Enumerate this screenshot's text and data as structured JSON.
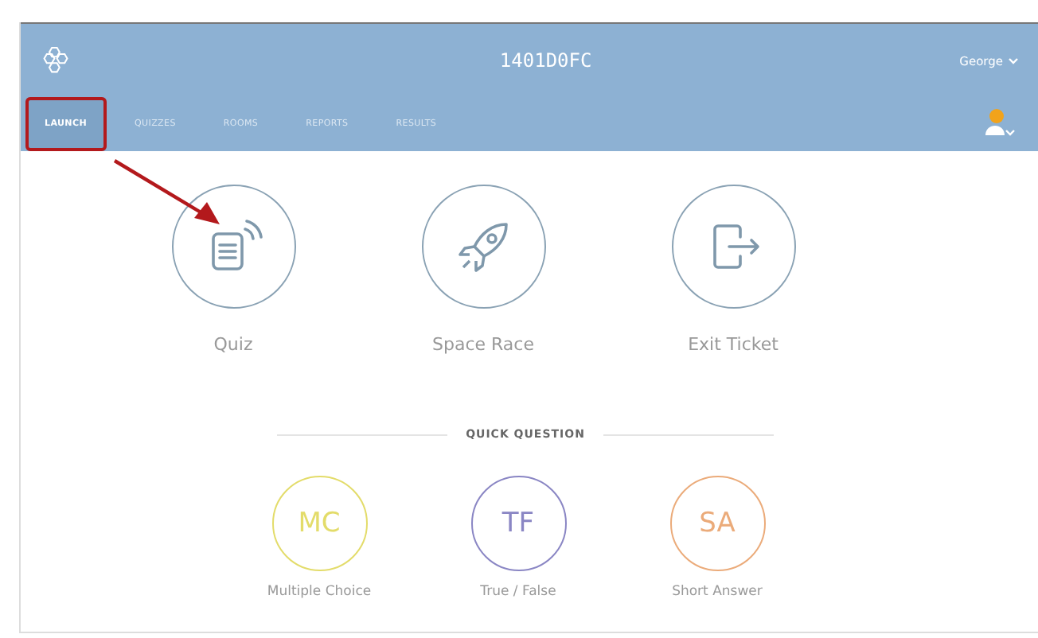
{
  "header": {
    "title": "1401D0FC",
    "user": "George",
    "notification_badge": true
  },
  "tabs": [
    {
      "label": "LAUNCH",
      "selected": true,
      "annotated": true
    },
    {
      "label": "QUIZZES",
      "selected": false,
      "annotated": false
    },
    {
      "label": "ROOMS",
      "selected": false,
      "annotated": false
    },
    {
      "label": "REPORTS",
      "selected": false,
      "annotated": false
    },
    {
      "label": "RESULTS",
      "selected": false,
      "annotated": false
    }
  ],
  "launch_options": [
    {
      "kind": "quiz",
      "label": "Quiz"
    },
    {
      "kind": "rocket",
      "label": "Space Race"
    },
    {
      "kind": "exit",
      "label": "Exit Ticket"
    }
  ],
  "quick_question": {
    "title": "QUICK QUESTION",
    "options": [
      {
        "abbr": "MC",
        "label": "Multiple Choice",
        "color": "#e3dc6a"
      },
      {
        "abbr": "TF",
        "label": "True / False",
        "color": "#8a86c4"
      },
      {
        "abbr": "SA",
        "label": "Short Answer",
        "color": "#ebab7a"
      }
    ]
  }
}
